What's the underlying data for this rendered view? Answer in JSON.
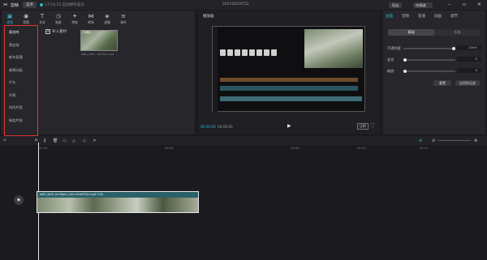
{
  "titlebar": {
    "app_name": "剪映",
    "menu_label": "菜单",
    "save_status": "17:54:55 自动保存成功",
    "project_title": "20210203l752",
    "export_label": "导出",
    "shortcut_label": "快捷键"
  },
  "toolbar": {
    "items": [
      {
        "label": "视频",
        "icon": "▣"
      },
      {
        "label": "音频",
        "icon": "◉"
      },
      {
        "label": "文本",
        "icon": "T"
      },
      {
        "label": "贴纸",
        "icon": "◷"
      },
      {
        "label": "特效",
        "icon": "✦"
      },
      {
        "label": "转场",
        "icon": "⋈"
      },
      {
        "label": "滤镜",
        "icon": "◈"
      },
      {
        "label": "调节",
        "icon": "≡"
      }
    ]
  },
  "sidebar": {
    "items": [
      "素材库",
      "黑白场",
      "新年氛围",
      "故障动画",
      "片头",
      "片尾",
      "时间片段",
      "搞笑片段"
    ]
  },
  "media": {
    "import_label": "导入素材",
    "thumb_badge": "已添加",
    "file_name": "with_with...0d234.mp4"
  },
  "player": {
    "title": "播放器",
    "current_time": "00:00:00",
    "total_time": "00:00:05",
    "ratio_label": "比例"
  },
  "props": {
    "tabs": [
      "画面",
      "音频",
      "变速",
      "动画",
      "调节"
    ],
    "segments": [
      "基础",
      "抠像"
    ],
    "rows": [
      {
        "label": "不透明度",
        "value": "100%"
      },
      {
        "label": "混合",
        "value": "0"
      },
      {
        "label": "缩放",
        "value": "0"
      }
    ],
    "reset_label": "重置",
    "apply_all_label": "应用到全部"
  },
  "timeline": {
    "ticks": [
      "00:00",
      "00:04",
      "00:08",
      "00:10",
      "00:12"
    ],
    "clip_label": "with_with_multiple_cats.rfcbd234.mp4   5.0s"
  },
  "colors": {
    "accent": "#2fb4c7",
    "highlight_border": "#e23838"
  }
}
